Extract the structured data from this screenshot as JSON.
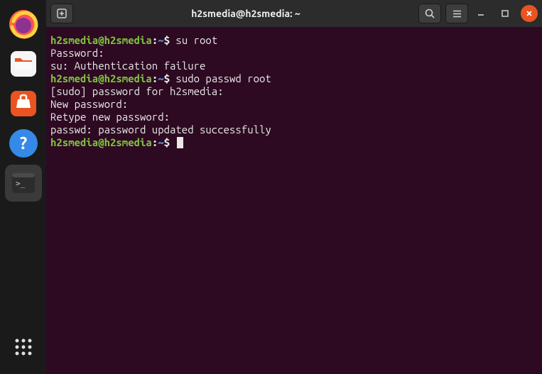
{
  "titlebar": {
    "title": "h2smedia@h2smedia: ~"
  },
  "dock": {
    "items": [
      {
        "name": "firefox"
      },
      {
        "name": "files"
      },
      {
        "name": "software"
      },
      {
        "name": "help"
      },
      {
        "name": "terminal"
      }
    ]
  },
  "terminal": {
    "prompt_user": "h2smedia@h2smedia",
    "prompt_sep_colon": ":",
    "prompt_path": "~",
    "prompt_dollar": "$",
    "lines": {
      "cmd1": " su root",
      "l2": "Password:",
      "l3": "su: Authentication failure",
      "cmd2": " sudo passwd root",
      "l5": "[sudo] password for h2smedia:",
      "l6": "New password:",
      "l7": "Retype new password:",
      "l8": "passwd: password updated successfully",
      "cmd3": " "
    }
  }
}
